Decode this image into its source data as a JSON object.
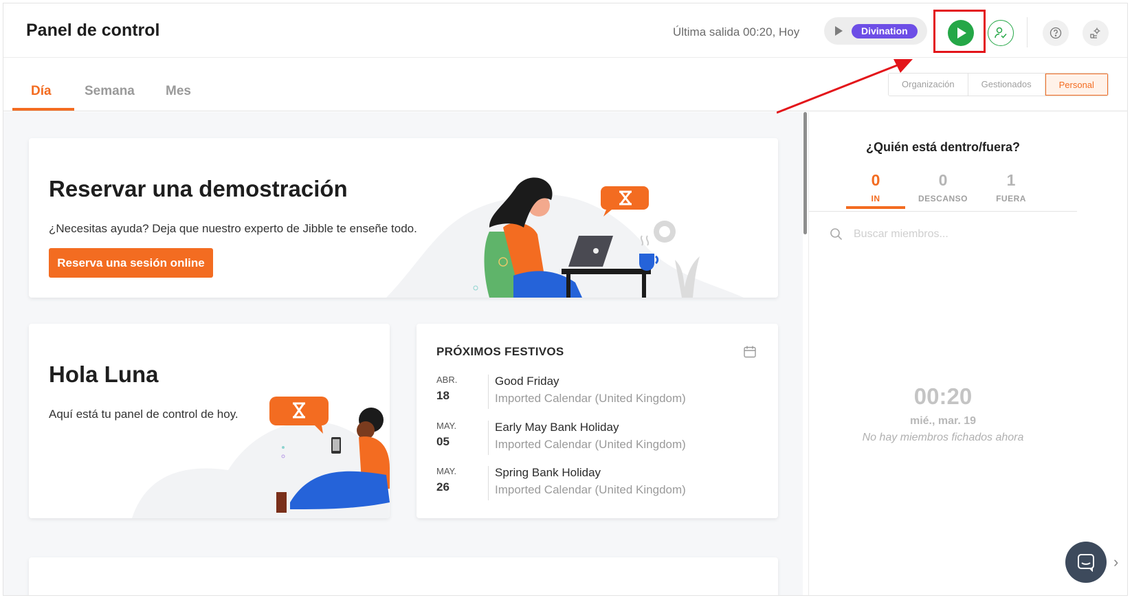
{
  "header": {
    "title": "Panel de control",
    "last_out": "Última salida 00:20, Hoy",
    "project": "Divination"
  },
  "tabs": [
    {
      "label": "Día",
      "active": true
    },
    {
      "label": "Semana",
      "active": false
    },
    {
      "label": "Mes",
      "active": false
    }
  ],
  "scope": [
    {
      "label": "Organización",
      "active": false
    },
    {
      "label": "Gestionados",
      "active": false
    },
    {
      "label": "Personal",
      "active": true
    }
  ],
  "demo": {
    "title": "Reservar una demostración",
    "subtitle": "¿Necesitas ayuda? Deja que nuestro experto de Jibble te enseñe todo.",
    "button": "Reserva una sesión online"
  },
  "hello": {
    "title": "Hola Luna",
    "subtitle": "Aquí está tu panel de control de hoy."
  },
  "holidays": {
    "title": "PRÓXIMOS FESTIVOS",
    "items": [
      {
        "month": "ABR.",
        "day": "18",
        "name": "Good Friday",
        "calendar": "Imported Calendar (United Kingdom)"
      },
      {
        "month": "MAY.",
        "day": "05",
        "name": "Early May Bank Holiday",
        "calendar": "Imported Calendar (United Kingdom)"
      },
      {
        "month": "MAY.",
        "day": "26",
        "name": "Spring Bank Holiday",
        "calendar": "Imported Calendar (United Kingdom)"
      }
    ]
  },
  "who": {
    "title": "¿Quién está dentro/fuera?",
    "stats": [
      {
        "value": "0",
        "label": "IN",
        "active": true
      },
      {
        "value": "0",
        "label": "DESCANSO",
        "active": false
      },
      {
        "value": "1",
        "label": "FUERA",
        "active": false
      }
    ],
    "search_placeholder": "Buscar miembros...",
    "time": "00:20",
    "date": "mié., mar. 19",
    "empty_message": "No hay miembros fichados ahora"
  },
  "colors": {
    "accent": "#f36c21",
    "play_green": "#25a747",
    "project_purple": "#6d4ee6",
    "annotation_red": "#e3151a",
    "chat_dark": "#3d4a5c"
  },
  "icons": [
    "play-icon",
    "user-check-icon",
    "help-icon",
    "settings-icon",
    "calendar-icon",
    "search-icon",
    "chat-icon",
    "chevron-right-icon"
  ]
}
